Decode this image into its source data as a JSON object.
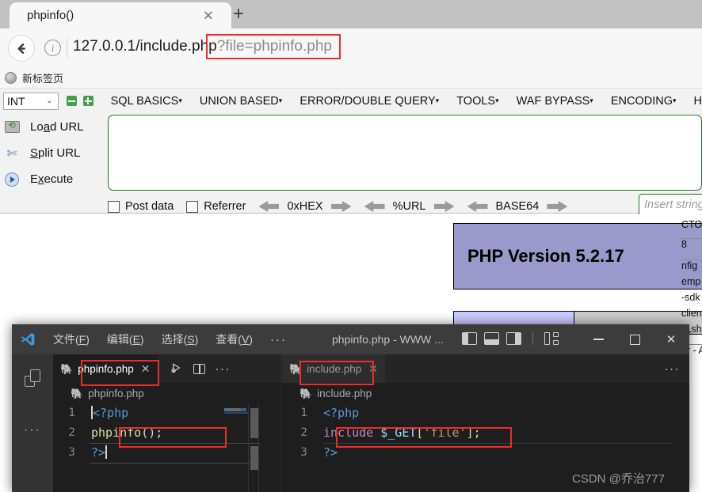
{
  "browser": {
    "tab": {
      "title": "phpinfo()",
      "close_label": "✕",
      "new_tab_label": "+"
    },
    "nav": {
      "back_label": "◀",
      "info_label": "i"
    },
    "url": {
      "host": "127.0.0.1/include.php",
      "query": "?file=phpinfo.php"
    },
    "bookmarks": [
      {
        "label": "新标签页",
        "icon": "globe-icon"
      }
    ]
  },
  "hackbar": {
    "type_select": {
      "value": "INT",
      "chevron": "⌄"
    },
    "minus_label": "−",
    "plus_label": "+",
    "menus": [
      {
        "label": "SQL BASICS",
        "caret": "▾"
      },
      {
        "label": "UNION BASED",
        "caret": "▾"
      },
      {
        "label": "ERROR/DOUBLE QUERY",
        "caret": "▾"
      },
      {
        "label": "TOOLS",
        "caret": "▾"
      },
      {
        "label": "WAF BYPASS",
        "caret": "▾"
      },
      {
        "label": "ENCODING",
        "caret": "▾"
      },
      {
        "label": "H",
        "caret": ""
      }
    ],
    "buttons": [
      {
        "label_pre": "Lo",
        "label_accel": "a",
        "label_post": "d URL",
        "icon": "load-url-icon"
      },
      {
        "label_pre": "",
        "label_accel": "S",
        "label_post": "plit URL",
        "icon": "split-url-icon"
      },
      {
        "label_pre": "E",
        "label_accel": "x",
        "label_post": "ecute",
        "icon": "execute-icon"
      }
    ],
    "textarea_value": "",
    "checkboxes": [
      {
        "label": "Post data",
        "checked": false
      },
      {
        "label": "Referrer",
        "checked": false
      }
    ],
    "encoders": [
      "0xHEX",
      "%URL",
      "BASE64"
    ],
    "insert_placeholder": "Insert string"
  },
  "page": {
    "php_version": "PHP Version 5.2.17",
    "right_strip": [
      "CTOR",
      "8",
      "nfig",
      "emp",
      "-sdk",
      "clien",
      "lk,sh",
      "er - A"
    ]
  },
  "vscode": {
    "titlebar": {
      "logo": "vscode-logo-icon",
      "menus": [
        {
          "pre": "文件(",
          "accel": "F",
          "post": ")"
        },
        {
          "pre": "编辑(",
          "accel": "E",
          "post": ")"
        },
        {
          "pre": "选择(",
          "accel": "S",
          "post": ")"
        },
        {
          "pre": "查看(",
          "accel": "V",
          "post": ")"
        }
      ],
      "overflow": "···",
      "document_title": "phpinfo.php - WWW ...",
      "layout_icons": [
        "panel-left-icon",
        "panel-bottom-icon",
        "panel-right-icon",
        "customize-layout-icon"
      ],
      "window_buttons": {
        "minimize": "—",
        "maximize": "□",
        "close": "✕"
      }
    },
    "activitybar": {
      "icons": [
        "explorer-copy-icon"
      ],
      "overflow": "···"
    },
    "groups": [
      {
        "tab": {
          "label": "phpinfo.php",
          "icon": "php-elephant-icon",
          "close": "✕",
          "active": true
        },
        "actions": [
          "run-debug-icon",
          "split-editor-icon",
          "more-actions-icon"
        ],
        "breadcrumb": {
          "icon": "php-elephant-icon",
          "label": "phpinfo.php"
        },
        "lines": [
          {
            "no": "1",
            "tokens": [
              {
                "t": "<?php",
                "c": "t-tag"
              }
            ]
          },
          {
            "no": "2",
            "tokens": [
              {
                "t": "phpinfo",
                "c": "t-fn"
              },
              {
                "t": "();",
                "c": "t-punct"
              }
            ]
          },
          {
            "no": "3",
            "tokens": [
              {
                "t": "?>",
                "c": "t-tag"
              }
            ]
          }
        ]
      },
      {
        "tab": {
          "label": "include.php",
          "icon": "php-elephant-icon",
          "close": "✕",
          "active": false
        },
        "actions": [
          "more-actions-icon"
        ],
        "breadcrumb": {
          "icon": "php-elephant-icon",
          "label": "include.php"
        },
        "lines": [
          {
            "no": "1",
            "tokens": [
              {
                "t": "<?php",
                "c": "t-tag"
              }
            ]
          },
          {
            "no": "2",
            "tokens": [
              {
                "t": "include",
                "c": "t-kw"
              },
              {
                "t": " ",
                "c": "t-punct"
              },
              {
                "t": "$_GET",
                "c": "t-var"
              },
              {
                "t": "[",
                "c": "t-punct"
              },
              {
                "t": "'file'",
                "c": "t-str"
              },
              {
                "t": "];",
                "c": "t-punct"
              }
            ]
          },
          {
            "no": "3",
            "tokens": [
              {
                "t": "?>",
                "c": "t-tag"
              }
            ]
          }
        ]
      }
    ]
  },
  "watermark": "CSDN @乔治777",
  "colors": {
    "highlight_box": "#f02b2b",
    "php_banner_bg": "#9999cc",
    "hackbar_border": "#1f7a1f",
    "vscode_titlebar": "#3c3c3c",
    "vscode_editor": "#1e1e1e"
  }
}
